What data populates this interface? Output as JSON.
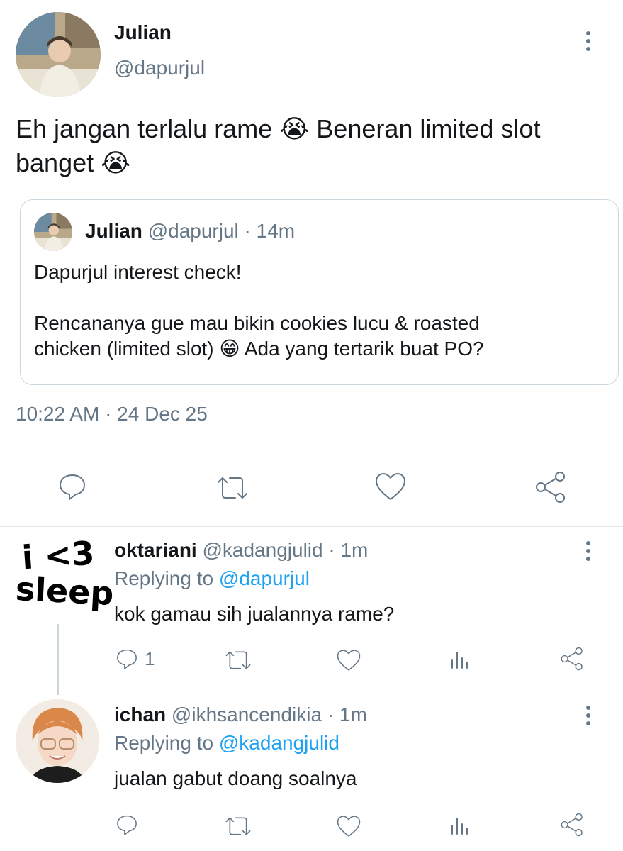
{
  "main_tweet": {
    "name": "Julian",
    "handle": "@dapurjul",
    "text_line1": "Eh jangan terlalu rame 😭 Beneran limited slot",
    "text_line2": "banget 😭",
    "timestamp": "10:22 AM · 24 Dec 25"
  },
  "quoted_tweet": {
    "name": "Julian",
    "handle": "@dapurjul",
    "time": "· 14m",
    "line1": "Dapurjul interest check!",
    "line2": "Rencananya gue mau bikin cookies lucu & roasted",
    "line3": "chicken (limited slot) 😁 Ada yang tertarik buat PO?"
  },
  "replies": [
    {
      "name": "oktariani",
      "handle": "@kadangjulid",
      "time": "· 1m",
      "replying_prefix": "Replying to",
      "replying_to": "@dapurjul",
      "text": "kok gamau sih jualannya rame?",
      "reply_count": "1",
      "avatar_text_1": "i <3",
      "avatar_text_2": "sleep"
    },
    {
      "name": "ichan",
      "handle": "@ikhsancendikia",
      "time": "· 1m",
      "replying_prefix": "Replying to",
      "replying_to": "@kadangjulid",
      "text": "jualan gabut doang soalnya",
      "reply_count": ""
    }
  ],
  "icons": [
    "more-vertical-icon",
    "reply-icon",
    "retweet-icon",
    "like-icon",
    "share-icon",
    "analytics-icon"
  ],
  "colors": {
    "link": "#1da1f2",
    "muted": "#657786",
    "border": "#ccd6dd"
  }
}
